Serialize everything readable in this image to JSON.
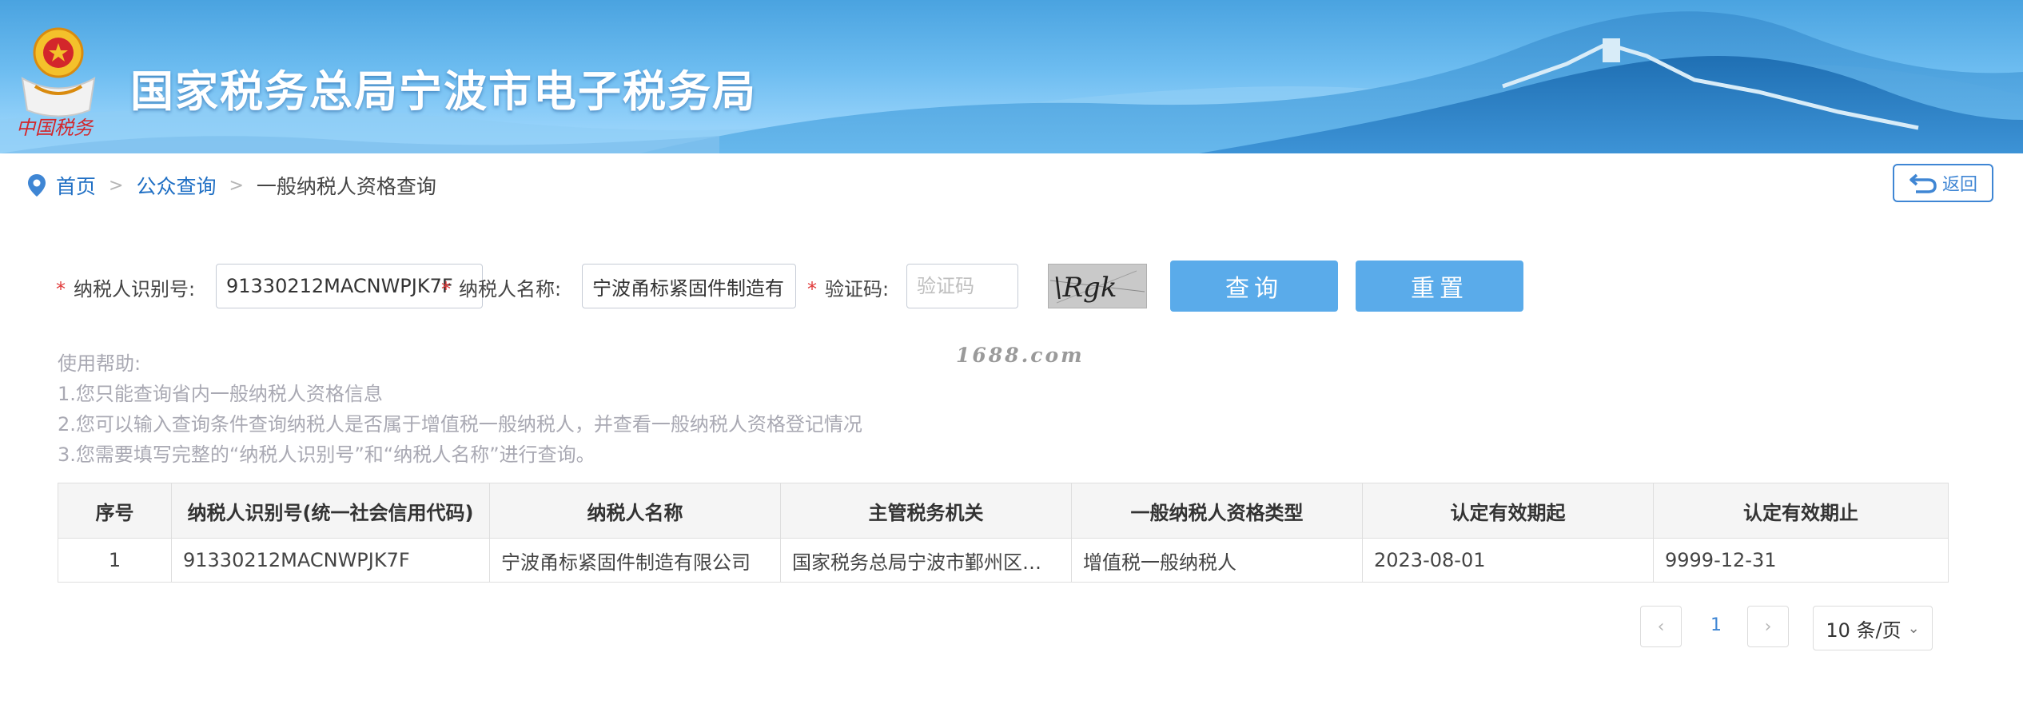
{
  "header": {
    "title": "国家税务总局宁波市电子税务局",
    "emblem_text": "中国税务"
  },
  "breadcrumb": {
    "icon": "location-pin-icon",
    "items": [
      "首页",
      "公众查询",
      "一般纳税人资格查询"
    ],
    "separator": ">"
  },
  "back_button": {
    "label": "返回",
    "icon": "return-arrow-icon"
  },
  "form": {
    "taxpayer_id": {
      "label": "纳税人识别号:",
      "value": "91330212MACNWPJK7F"
    },
    "taxpayer_name": {
      "label": "纳税人名称:",
      "value": "宁波甬标紧固件制造有限公司"
    },
    "captcha": {
      "label": "验证码:",
      "value": "",
      "placeholder": "验证码",
      "image_text": "\\Rgk"
    },
    "required_mark": "*",
    "query_button": "查询",
    "reset_button": "重置"
  },
  "watermark": "1688.com",
  "help": {
    "title": "使用帮助:",
    "lines": [
      "1.您只能查询省内一般纳税人资格信息",
      "2.您可以输入查询条件查询纳税人是否属于增值税一般纳税人，并查看一般纳税人资格登记情况",
      "3.您需要填写完整的“纳税人识别号”和“纳税人名称”进行查询。"
    ]
  },
  "table": {
    "headers": [
      "序号",
      "纳税人识别号(统一社会信用代码)",
      "纳税人名称",
      "主管税务机关",
      "一般纳税人资格类型",
      "认定有效期起",
      "认定有效期止"
    ],
    "rows": [
      [
        "1",
        "91330212MACNWPJK7F",
        "宁波甬标紧固件制造有限公司",
        "国家税务总局宁波市鄞州区…",
        "增值税一般纳税人",
        "2023-08-01",
        "9999-12-31"
      ]
    ]
  },
  "pagination": {
    "prev": "‹",
    "current_page": "1",
    "next": "›",
    "page_size": "10 条/页"
  },
  "colors": {
    "accent": "#3f86d4",
    "button": "#5aabea",
    "required": "#e03a3a"
  }
}
